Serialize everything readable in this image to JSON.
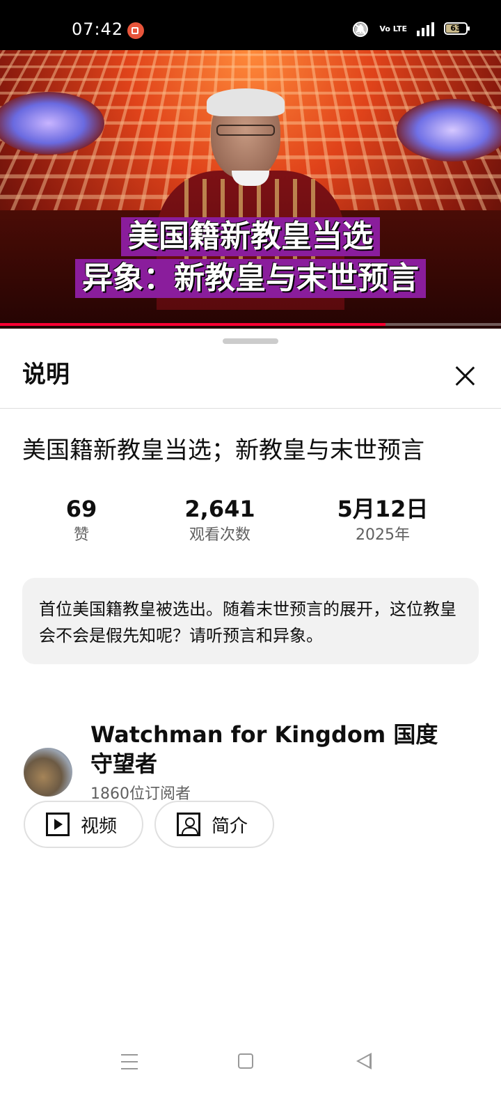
{
  "status_bar": {
    "time": "07:42",
    "icons": [
      "screen-record-icon",
      "mute-notification-icon",
      "volte-icon",
      "signal-4g-icon",
      "battery-icon"
    ],
    "volte_text": "Vo LTE",
    "network": "4G",
    "battery": "63"
  },
  "video": {
    "caption_line1": "美国籍新教皇当选",
    "caption_line2": "异象：新教皇与末世预言",
    "caption_bg_color": "#8a1d9c",
    "progress_fraction": 0.77
  },
  "sheet": {
    "title": "说明",
    "video_title": "美国籍新教皇当选；新教皇与末世预言",
    "stats": [
      {
        "value": "69",
        "label": "赞"
      },
      {
        "value": "2,641",
        "label": "观看次数"
      },
      {
        "value": "5月12日",
        "label": "2025年"
      }
    ],
    "description": "首位美国籍教皇被选出。随着末世预言的展开，这位教皇会不会是假先知呢？请听预言和异象。",
    "channel": {
      "name": "Watchman for Kingdom 国度守望者",
      "subscribers": "1860位订阅者"
    },
    "buttons": {
      "videos": "视频",
      "about": "简介"
    }
  },
  "nav_bar": {
    "icons": [
      "menu-icon",
      "home-icon",
      "back-icon"
    ]
  }
}
